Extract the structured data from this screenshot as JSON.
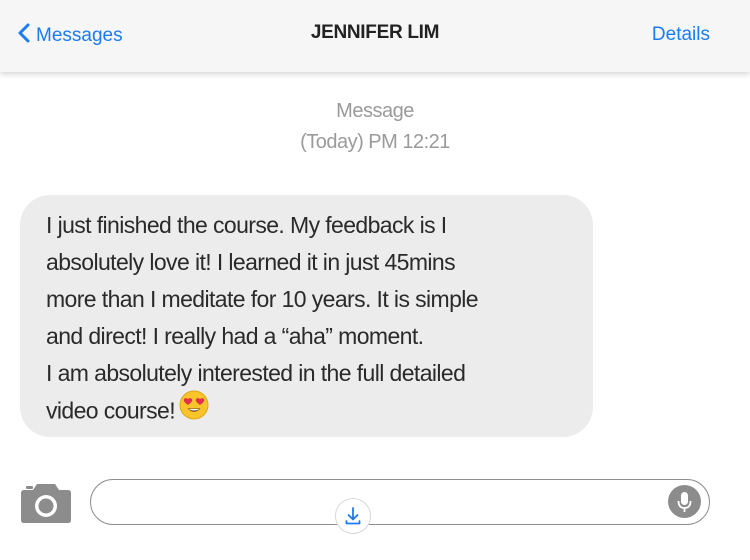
{
  "header": {
    "back_label": "Messages",
    "title": "JENNIFER LIM",
    "details_label": "Details"
  },
  "conversation": {
    "meta_label": "Message",
    "timestamp": "(Today) PM 12:21",
    "message_lines": [
      "I just finished the course. My feedback is I",
      "absolutely love it! I learned it in just 45mins",
      "more than I meditate for 10 years. It is simple",
      "and direct! I really had a “aha” moment.",
      "I am absolutely interested in the full detailed",
      "video course!"
    ],
    "emoji": "heart-eyes-emoji"
  },
  "composer": {
    "camera_icon": "camera-icon",
    "mic_icon": "microphone-icon",
    "download_icon": "download-icon",
    "input_value": ""
  },
  "colors": {
    "accent": "#1a7cf0",
    "bubble": "#ececec",
    "header_bg": "#f6f6f6",
    "meta_text": "#9a9a9a"
  }
}
